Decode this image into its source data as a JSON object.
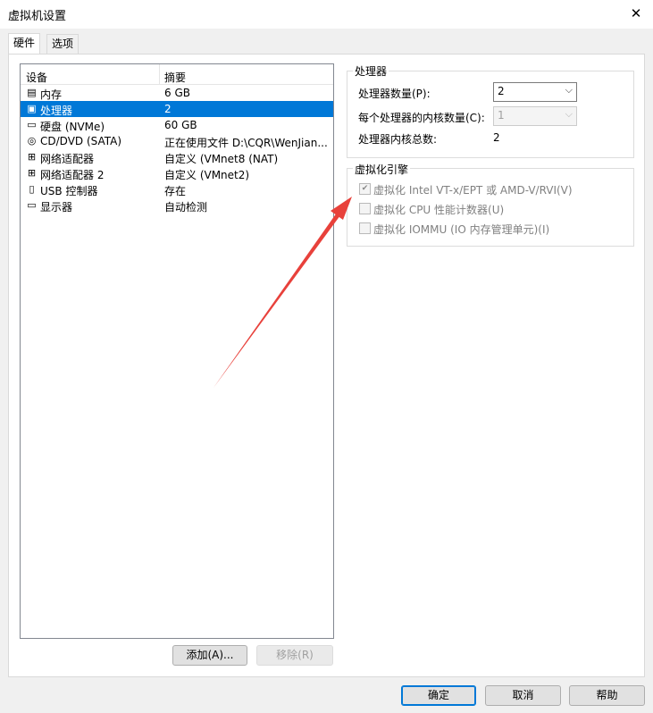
{
  "window": {
    "title": "虚拟机设置",
    "close_icon": "close-icon"
  },
  "tabs": [
    {
      "label": "硬件",
      "active": true
    },
    {
      "label": "选项",
      "active": false
    }
  ],
  "device_list": {
    "col_device": "设备",
    "col_summary": "摘要",
    "rows": [
      {
        "icon": "memory-icon",
        "name": "内存",
        "summary": "6 GB",
        "selected": false
      },
      {
        "icon": "cpu-icon",
        "name": "处理器",
        "summary": "2",
        "selected": true
      },
      {
        "icon": "disk-icon",
        "name": "硬盘 (NVMe)",
        "summary": "60 GB",
        "selected": false
      },
      {
        "icon": "cdrom-icon",
        "name": "CD/DVD (SATA)",
        "summary": "正在使用文件 D:\\CQR\\WenJian...",
        "selected": false
      },
      {
        "icon": "network-icon",
        "name": "网络适配器",
        "summary": "自定义 (VMnet8 (NAT)",
        "selected": false
      },
      {
        "icon": "network-icon",
        "name": "网络适配器 2",
        "summary": "自定义 (VMnet2)",
        "selected": false
      },
      {
        "icon": "usb-icon",
        "name": "USB 控制器",
        "summary": "存在",
        "selected": false
      },
      {
        "icon": "monitor-icon",
        "name": "显示器",
        "summary": "自动检测",
        "selected": false
      }
    ]
  },
  "list_buttons": {
    "add": "添加(A)...",
    "remove": "移除(R)"
  },
  "processor": {
    "group_title": "处理器",
    "count_label": "处理器数量(P):",
    "count_value": "2",
    "cores_label": "每个处理器的内核数量(C):",
    "cores_value": "1",
    "total_label": "处理器内核总数:",
    "total_value": "2"
  },
  "virtualization": {
    "group_title": "虚拟化引擎",
    "options": [
      {
        "label": "虚拟化 Intel VT-x/EPT 或 AMD-V/RVI(V)",
        "checked": true
      },
      {
        "label": "虚拟化 CPU 性能计数器(U)",
        "checked": false
      },
      {
        "label": "虚拟化 IOMMU (IO 内存管理单元)(I)",
        "checked": false
      }
    ]
  },
  "dialog_buttons": {
    "ok": "确定",
    "cancel": "取消",
    "help": "帮助"
  },
  "colors": {
    "selection": "#0078d7",
    "annotation_arrow": "#e8413b"
  }
}
